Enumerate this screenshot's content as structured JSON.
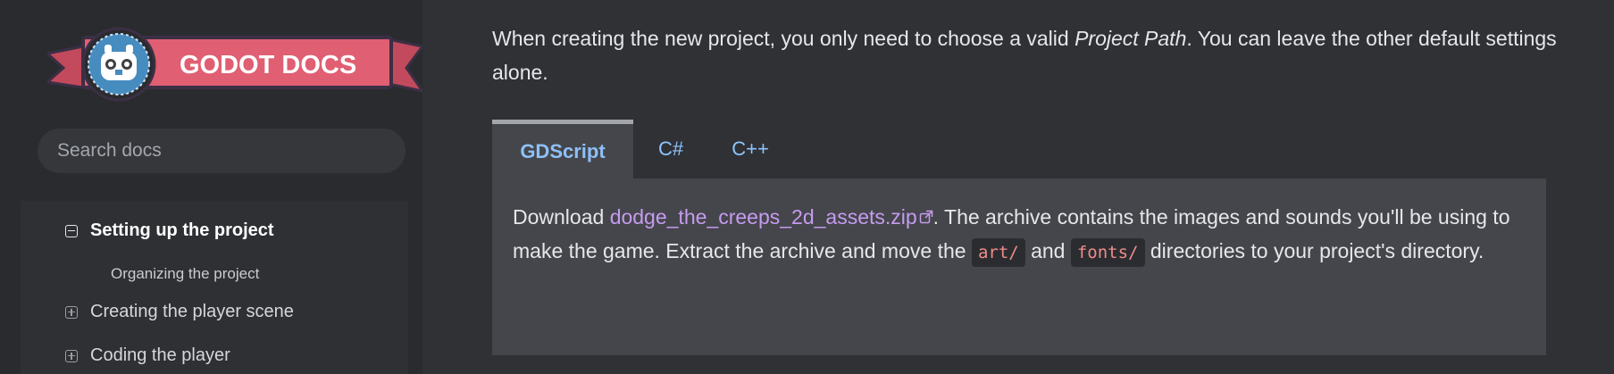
{
  "sidebar": {
    "logo_text": "GODOT DOCS",
    "search": {
      "placeholder": "Search docs",
      "value": ""
    },
    "nav": [
      {
        "label": "Setting up the project",
        "state": "expanded",
        "current": true
      },
      {
        "label": "Organizing the project",
        "state": "sub"
      },
      {
        "label": "Creating the player scene",
        "state": "collapsed"
      },
      {
        "label": "Coding the player",
        "state": "collapsed"
      }
    ]
  },
  "main": {
    "intro_before": "When creating the new project, you only need to choose a valid ",
    "intro_em": "Project Path",
    "intro_after": ". You can leave the other default settings alone.",
    "tabs": [
      {
        "label": "GDScript",
        "active": true
      },
      {
        "label": "C#",
        "active": false
      },
      {
        "label": "C++",
        "active": false
      }
    ],
    "panel": {
      "text_1": "Download ",
      "link_text": "dodge_the_creeps_2d_assets.zip",
      "text_2": ". The archive contains the images and sounds you'll be using to make the game. Extract the archive and move the ",
      "code_1": "art/",
      "text_3": " and ",
      "code_2": "fonts/",
      "text_4": " directories to your project's directory."
    }
  },
  "colors": {
    "background": "#2f3135",
    "sidebar": "#2a2b2f",
    "panel": "#45464b",
    "tab_link": "#8fc5ff",
    "link": "#c69bf0",
    "code": "#f08c8a",
    "logo_ribbon": "#e05f72",
    "logo_circle": "#478cbf"
  },
  "icons": {
    "expanded": "minus-square-icon",
    "collapsed": "plus-square-icon",
    "external": "external-link-icon",
    "logo": "godot-robot-icon"
  }
}
